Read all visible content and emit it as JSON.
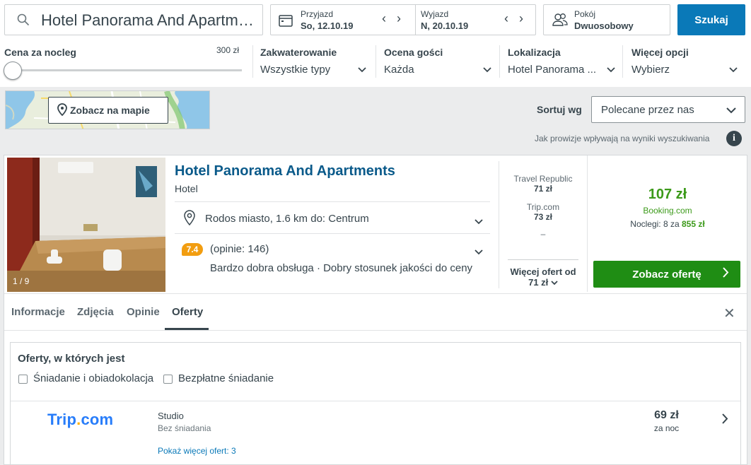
{
  "search": {
    "query": "Hotel Panorama And Apartments"
  },
  "dates": {
    "checkin_label": "Przyjazd",
    "checkin_value": "So, 12.10.19",
    "checkout_label": "Wyjazd",
    "checkout_value": "N, 20.10.19"
  },
  "room": {
    "label": "Pokój",
    "value": "Dwuosobowy"
  },
  "search_button": "Szukaj",
  "filters": {
    "price_label": "Cena za nocleg",
    "price_max": "300 zł",
    "price_slider_fraction": 0.0,
    "accommodation_label": "Zakwaterowanie",
    "accommodation_value": "Wszystkie typy",
    "rating_label": "Ocena gości",
    "rating_value": "Każda",
    "location_label": "Lokalizacja",
    "location_value": "Hotel Panorama ...",
    "more_label": "Więcej opcji",
    "more_value": "Wybierz"
  },
  "map_button": "Zobacz na mapie",
  "sort": {
    "label": "Sortuj wg",
    "value": "Polecane przez nas"
  },
  "provision_note": "Jak prowizje wpływają na wyniki wyszukiwania",
  "hotel": {
    "photo_counter": "1 / 9",
    "name": "Hotel Panorama And Apartments",
    "type": "Hotel",
    "location": "Rodos miasto, 1.6 km do: Centrum",
    "rating": "7.4",
    "reviews": "(opinie: 146)",
    "tags": "Bardzo dobra obsługa · Dobry stosunek jakości do ceny"
  },
  "providers": [
    {
      "name": "Travel Republic",
      "price": "71 zł"
    },
    {
      "name": "Trip.com",
      "price": "73 zł"
    }
  ],
  "provider_placeholder": "–",
  "more_offers": {
    "line1": "Więcej ofert od",
    "line2": "71 zł"
  },
  "best_offer": {
    "price": "107 zł",
    "provider": "Booking.com",
    "nights_text": "Noclegi: 8 za",
    "nights_total": "855 zł",
    "button": "Zobacz ofertę"
  },
  "tabs": [
    "Informacje",
    "Zdjęcia",
    "Opinie",
    "Oferty"
  ],
  "close_icon": "✕",
  "offers": {
    "title": "Oferty, w których jest",
    "filters": [
      "Śniadanie i obiadokolacja",
      "Bezpłatne śniadanie"
    ],
    "items": [
      {
        "logo": {
          "main": "Trip",
          "dot": ".",
          "tail": "com"
        },
        "room": "Studio",
        "board": "Bez śniadania",
        "more_link": "Pokaż więcej ofert: 3",
        "price": "69 zł",
        "per": "za noc"
      }
    ]
  },
  "colors": {
    "accent": "#0a79b8",
    "green": "#1f8d14",
    "rating": "#f29d10"
  }
}
